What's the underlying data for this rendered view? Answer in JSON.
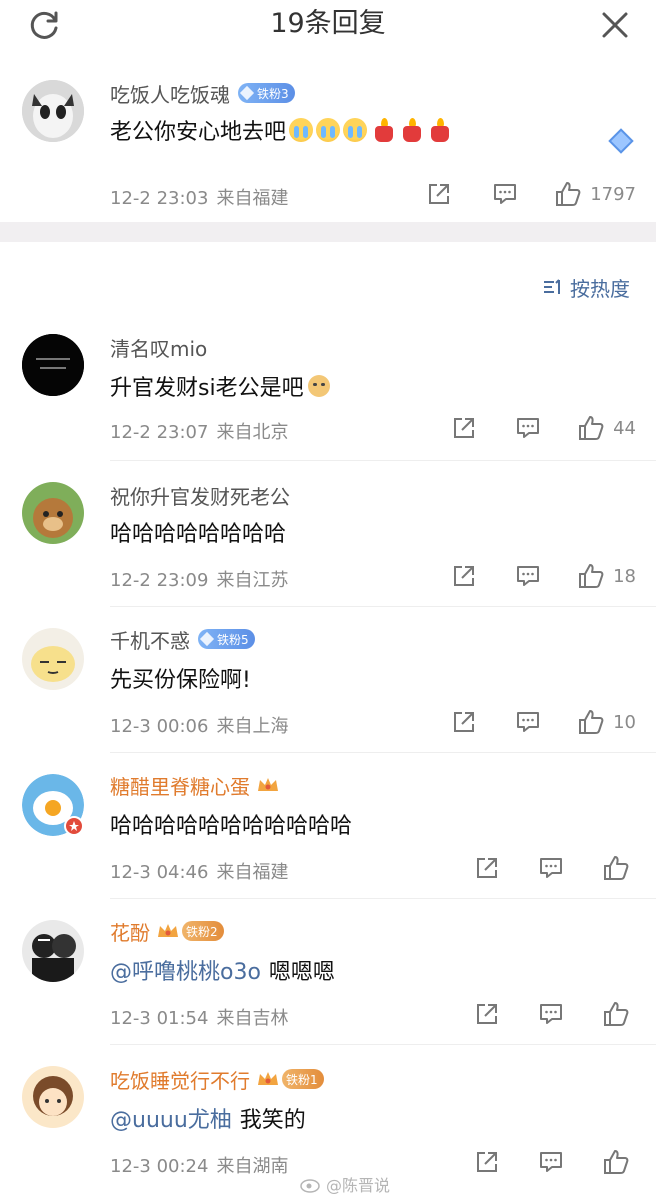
{
  "header": {
    "title": "19条回复",
    "refresh_icon": "refresh-icon",
    "close_icon": "close-icon"
  },
  "root_comment": {
    "username": "吃饭人吃饭魂",
    "badge": "铁粉3",
    "text": "老公你安心地去吧",
    "emojis": [
      "crying-face",
      "crying-face",
      "crying-face",
      "candle",
      "candle",
      "candle"
    ],
    "time": "12-2 23:03",
    "location": "来自福建",
    "likes": "1797"
  },
  "sort": {
    "label": "按热度"
  },
  "replies": [
    {
      "username": "清名叹mio",
      "badge": "",
      "vip": false,
      "text": "升官发财si老公是吧",
      "emoji": "doge",
      "time": "12-2 23:07",
      "location": "来自北京",
      "likes": "44"
    },
    {
      "username": "祝你升官发财死老公",
      "badge": "",
      "vip": false,
      "text": "哈哈哈哈哈哈哈哈",
      "time": "12-2 23:09",
      "location": "来自江苏",
      "likes": "18"
    },
    {
      "username": "千机不惑",
      "badge": "铁粉5",
      "vip": false,
      "text": "先买份保险啊!",
      "time": "12-3 00:06",
      "location": "来自上海",
      "likes": "10"
    },
    {
      "username": "糖醋里脊糖心蛋",
      "badge": "",
      "vip": true,
      "text": "哈哈哈哈哈哈哈哈哈哈哈",
      "time": "12-3 04:46",
      "location": "来自福建",
      "likes": ""
    },
    {
      "username": "花酚",
      "badge": "铁粉2",
      "vip": true,
      "mention": "@呼噜桃桃o3o",
      "text": "嗯嗯嗯",
      "time": "12-3 01:54",
      "location": "来自吉林",
      "likes": ""
    },
    {
      "username": "吃饭睡觉行不行",
      "badge": "铁粉1",
      "vip": true,
      "mention": "@uuuu尤柚",
      "text": "我笑的",
      "time": "12-3 00:24",
      "location": "来自湖南",
      "likes": ""
    }
  ],
  "watermark": "@陈晋说",
  "colors": {
    "accent_blue": "#4a6d9e",
    "vip_orange": "#e07b2d",
    "meta_gray": "#8a8a8a"
  }
}
